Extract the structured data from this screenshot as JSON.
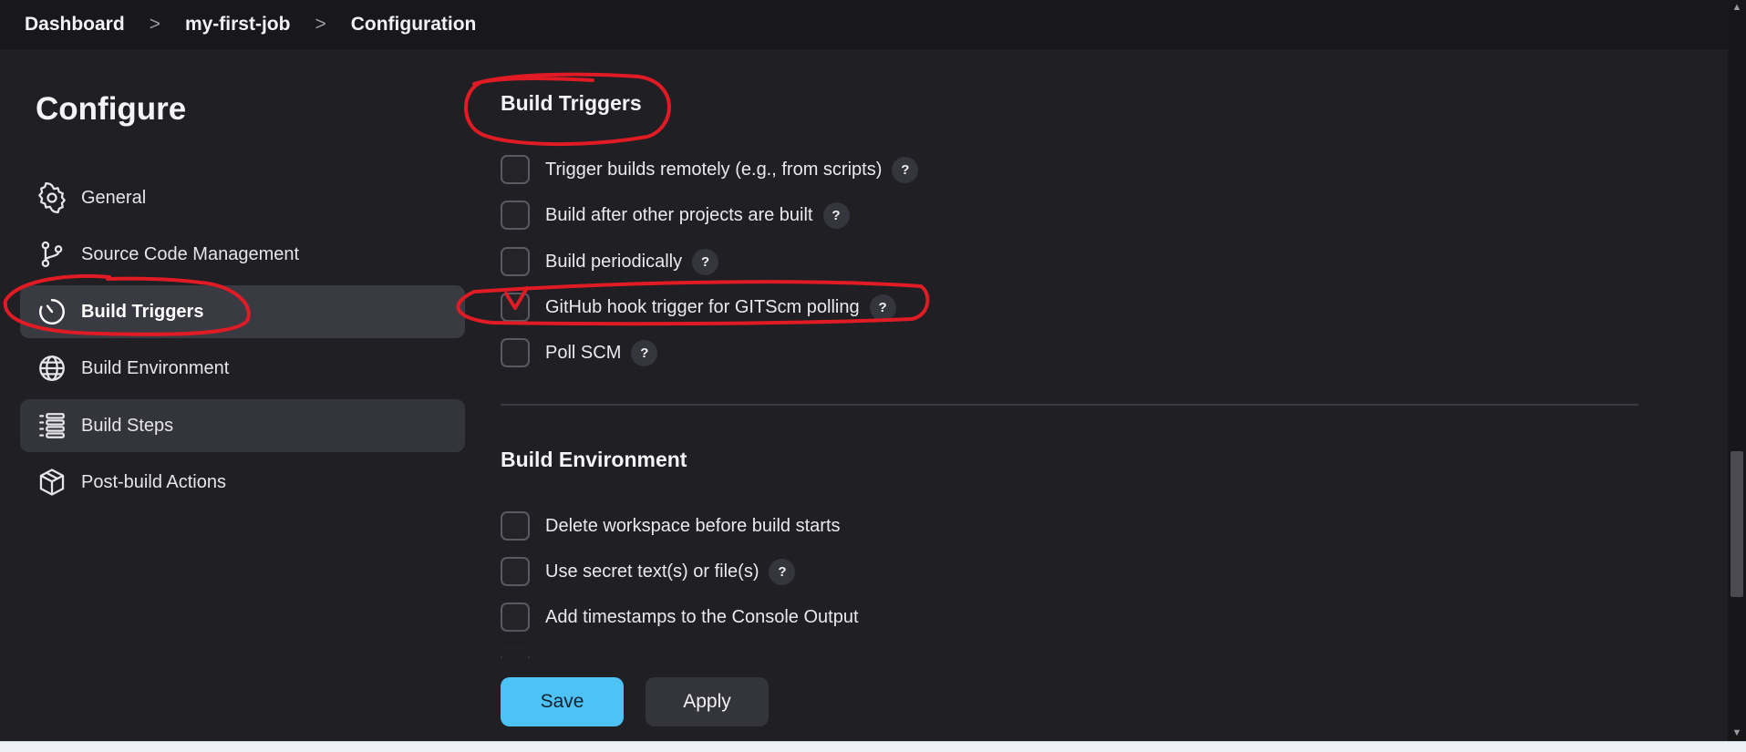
{
  "breadcrumb": {
    "items": [
      "Dashboard",
      "my-first-job",
      "Configuration"
    ],
    "separator": ">"
  },
  "sidebar": {
    "title": "Configure",
    "items": [
      {
        "label": "General",
        "icon": "gear-icon"
      },
      {
        "label": "Source Code Management",
        "icon": "git-branch-icon"
      },
      {
        "label": "Build Triggers",
        "icon": "timer-icon",
        "active": true
      },
      {
        "label": "Build Environment",
        "icon": "globe-icon"
      },
      {
        "label": "Build Steps",
        "icon": "list-icon"
      },
      {
        "label": "Post-build Actions",
        "icon": "package-icon"
      }
    ]
  },
  "build_triggers": {
    "title": "Build Triggers",
    "options": [
      {
        "label": "Trigger builds remotely (e.g., from scripts)",
        "checked": false,
        "help": "?"
      },
      {
        "label": "Build after other projects are built",
        "checked": false,
        "help": "?"
      },
      {
        "label": "Build periodically",
        "checked": false,
        "help": "?"
      },
      {
        "label": "GitHub hook trigger for GITScm polling",
        "checked": false,
        "help": "?"
      },
      {
        "label": "Poll SCM",
        "checked": false,
        "help": "?"
      }
    ]
  },
  "build_environment": {
    "title": "Build Environment",
    "options": [
      {
        "label": "Delete workspace before build starts",
        "checked": false
      },
      {
        "label": "Use secret text(s) or file(s)",
        "checked": false,
        "help": "?"
      },
      {
        "label": "Add timestamps to the Console Output",
        "checked": false
      }
    ]
  },
  "actions": {
    "save_label": "Save",
    "apply_label": "Apply"
  },
  "colors": {
    "background": "#1f1f24",
    "topbar": "#18181c",
    "active_item": "#3a3a43",
    "save_button": "#4cc2f5",
    "annotation": "#e01b24"
  }
}
